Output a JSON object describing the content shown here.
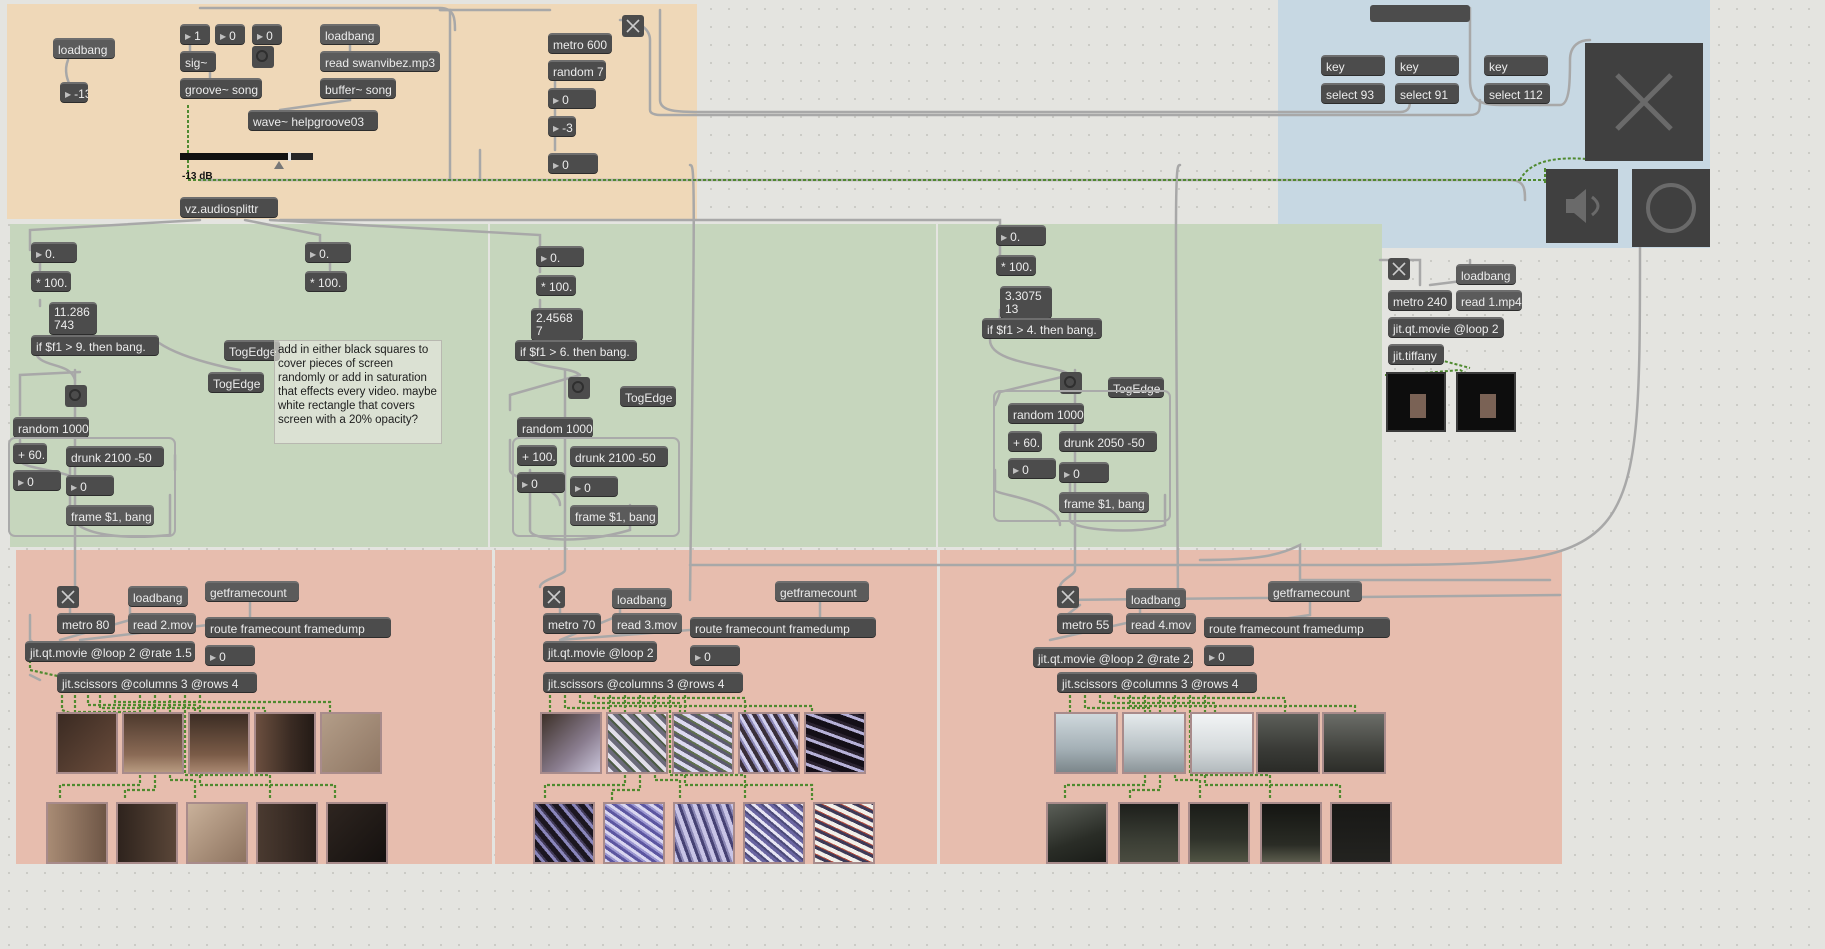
{
  "colors": {
    "canvas": "#e4e4e0",
    "panel_orange": "#efd8b8",
    "panel_green": "#c6d6bd",
    "panel_red": "#e7bdae",
    "panel_blue": "#c7d8e3",
    "object": "#4c4c4c",
    "cable": "#a8a8a8",
    "signal_cable": "#4f8a2f"
  },
  "audio": {
    "loadbang": "loadbang",
    "minus13": "-13",
    "num_1": "1",
    "num_0a": "0",
    "num_0b": "0",
    "sig": "sig~",
    "groove": "groove~ song",
    "loadbang2": "loadbang",
    "read_mp3": "read swanvibez.mp3",
    "buffer": "buffer~ song",
    "wave": "wave~ helpgroove03",
    "gain_readout": "-13 dB",
    "gain_level_fraction": 0.83,
    "splitter": "vz.audiosplittr"
  },
  "metro_group": {
    "metro": "metro 600",
    "random": "random 7",
    "num_a": "0",
    "num_b": "-3",
    "num_c": "0"
  },
  "keys": {
    "key1": "key",
    "key2": "key",
    "key3": "key",
    "select1": "select 93",
    "select2": "select 91",
    "select3": "select 112"
  },
  "analysis": {
    "col1": {
      "num_top": "0.",
      "num_b": "0.",
      "mult": "* 100.",
      "mult_b": "* 100.",
      "value": "11.286\n743",
      "cond": "if $f1 > 9. then bang.",
      "togedge_a": "TogEdge",
      "togedge_b": "TogEdge",
      "random": "random 1000",
      "plus": "+ 60.",
      "drunk": "drunk 2100 -50",
      "num_r": "0",
      "num_d": "0",
      "frame": "frame $1, bang"
    },
    "col2": {
      "num_top": "0.",
      "mult": "* 100.",
      "value": "2.4568\n7",
      "cond": "if $f1 > 6. then bang.",
      "togedge": "TogEdge",
      "random": "random 1000",
      "plus": "+ 100.",
      "drunk": "drunk 2100 -50",
      "num_r": "0",
      "num_d": "0",
      "frame": "frame $1, bang"
    },
    "col3": {
      "num_top": "0.",
      "mult": "* 100.",
      "value": "3.3075\n13",
      "cond": "if $f1 > 4. then bang.",
      "togedge": "TogEdge",
      "random": "random 1000",
      "plus": "+ 60.",
      "drunk": "drunk 2050 -50",
      "num_r": "0",
      "num_d": "0",
      "frame": "frame $1, bang"
    },
    "comment": "add in either black squares to cover pieces of screen randomly or add in saturation that effects every video. maybe white rectangle that covers screen with a 20% opacity?"
  },
  "side_player": {
    "metro": "metro 240",
    "loadbang": "loadbang",
    "read": "read 1.mp4",
    "movie": "jit.qt.movie @loop 2",
    "tiffany": "jit.tiffany"
  },
  "video_columns": [
    {
      "loadbang": "loadbang",
      "getframecount": "getframecount",
      "metro": "metro 80",
      "read": "read 2.mov",
      "route": "route framecount framedump",
      "movie": "jit.qt.movie @loop 2 @rate 1.5",
      "framecount": "0",
      "scissors": "jit.scissors @columns 3 @rows 4"
    },
    {
      "loadbang": "loadbang",
      "getframecount": "getframecount",
      "metro": "metro 70",
      "read": "read 3.mov",
      "route": "route framecount framedump",
      "movie": "jit.qt.movie @loop 2",
      "framecount": "0",
      "scissors": "jit.scissors @columns 3 @rows 4"
    },
    {
      "loadbang": "loadbang",
      "getframecount": "getframecount",
      "metro": "metro 55",
      "read": "read 4.mov",
      "route": "route framecount framedump",
      "movie": "jit.qt.movie @loop 2 @rate 2.",
      "framecount": "0",
      "scissors": "jit.scissors @columns 3 @rows 4"
    }
  ],
  "controls": {
    "close_icon": "close-x-icon",
    "speaker_icon": "speaker-icon",
    "circle_icon": "circle-button-icon"
  }
}
